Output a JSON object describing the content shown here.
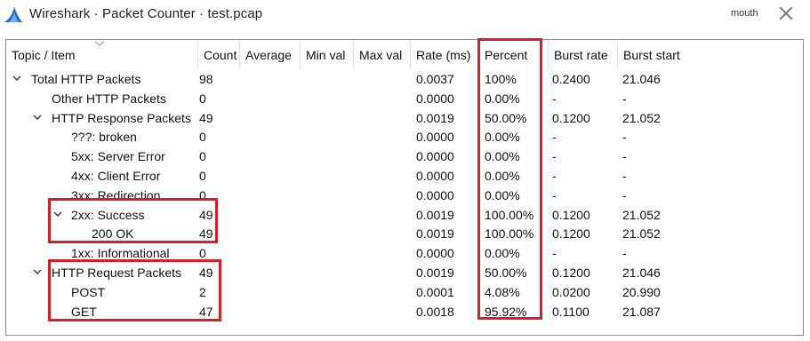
{
  "window": {
    "title": "Wireshark · Packet Counter · test.pcap",
    "user": "mouth"
  },
  "colors": {
    "annotation": "#d61f26",
    "border": "#8a8a8a",
    "icon": "#1f6fd1"
  },
  "columns": [
    "Topic / Item",
    "Count",
    "Average",
    "Min val",
    "Max val",
    "Rate (ms)",
    "Percent",
    "Burst rate",
    "Burst start"
  ],
  "rows": [
    {
      "topic": "Total HTTP Packets",
      "count": "98",
      "rate": "0.0037",
      "percent": "100%",
      "burst_rate": "0.2400",
      "burst_start": "21.046"
    },
    {
      "topic": "Other HTTP Packets",
      "count": "0",
      "rate": "0.0000",
      "percent": "0.00%",
      "burst_rate": "-",
      "burst_start": "-"
    },
    {
      "topic": "HTTP Response Packets",
      "count": "49",
      "rate": "0.0019",
      "percent": "50.00%",
      "burst_rate": "0.1200",
      "burst_start": "21.052"
    },
    {
      "topic": "???: broken",
      "count": "0",
      "rate": "0.0000",
      "percent": "0.00%",
      "burst_rate": "-",
      "burst_start": "-"
    },
    {
      "topic": "5xx: Server Error",
      "count": "0",
      "rate": "0.0000",
      "percent": "0.00%",
      "burst_rate": "-",
      "burst_start": "-"
    },
    {
      "topic": "4xx: Client Error",
      "count": "0",
      "rate": "0.0000",
      "percent": "0.00%",
      "burst_rate": "-",
      "burst_start": "-"
    },
    {
      "topic": "3xx: Redirection",
      "count": "0",
      "rate": "0.0000",
      "percent": "0.00%",
      "burst_rate": "-",
      "burst_start": "-"
    },
    {
      "topic": "2xx: Success",
      "count": "49",
      "rate": "0.0019",
      "percent": "100.00%",
      "burst_rate": "0.1200",
      "burst_start": "21.052"
    },
    {
      "topic": "200 OK",
      "count": "49",
      "rate": "0.0019",
      "percent": "100.00%",
      "burst_rate": "0.1200",
      "burst_start": "21.052"
    },
    {
      "topic": "1xx: Informational",
      "count": "0",
      "rate": "0.0000",
      "percent": "0.00%",
      "burst_rate": "-",
      "burst_start": "-"
    },
    {
      "topic": "HTTP Request Packets",
      "count": "49",
      "rate": "0.0019",
      "percent": "50.00%",
      "burst_rate": "0.1200",
      "burst_start": "21.046"
    },
    {
      "topic": "POST",
      "count": "2",
      "rate": "0.0001",
      "percent": "4.08%",
      "burst_rate": "0.0200",
      "burst_start": "20.990"
    },
    {
      "topic": "GET",
      "count": "47",
      "rate": "0.0018",
      "percent": "95.92%",
      "burst_rate": "0.1100",
      "burst_start": "21.087"
    }
  ]
}
